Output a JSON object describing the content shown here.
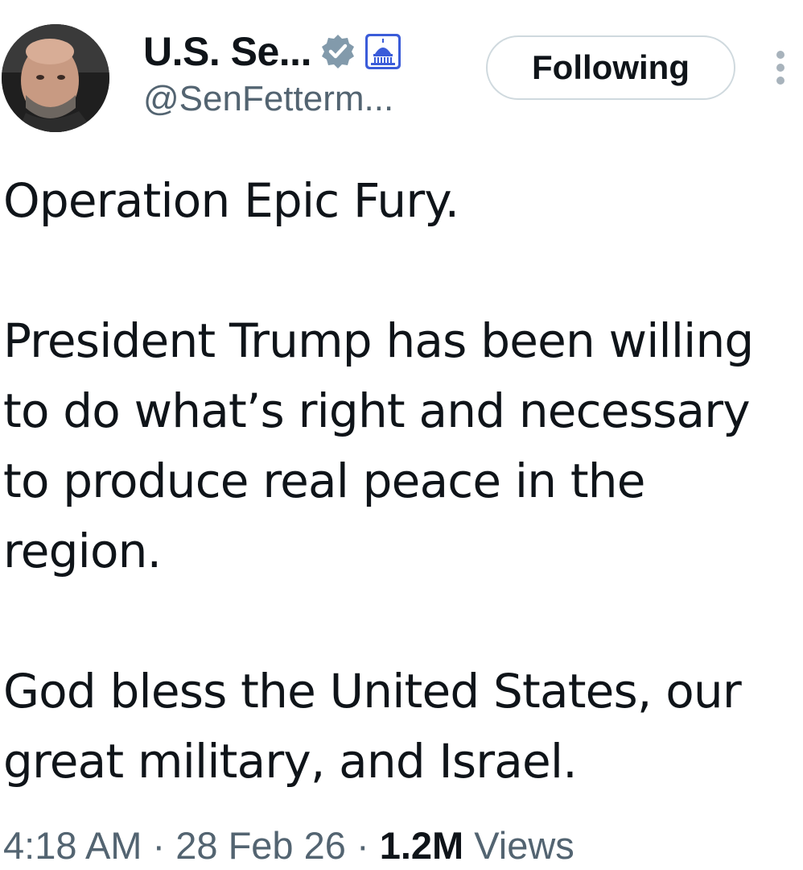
{
  "tweet": {
    "author": {
      "display_name": "U.S. Se...",
      "handle": "@SenFetterm...",
      "verified_badge_icon": "verified-badge-icon",
      "affiliation_icon": "capitol-dome-icon",
      "avatar": "profile-photo"
    },
    "follow_button_label": "Following",
    "more_icon": "more-vertical-icon",
    "paragraphs": [
      "Operation Epic Fury.",
      "President Trump has been willing to do what’s right and necessary to produce real peace in the region.",
      "God bless the United States, our great military, and Israel."
    ],
    "meta": {
      "time": "4:18 AM",
      "separator": " · ",
      "date": "28 Feb 26",
      "views_count": "1.2M",
      "views_label": "Views"
    }
  },
  "colors": {
    "text_primary": "#0f1419",
    "text_secondary": "#536471",
    "button_border": "#cfd9de",
    "badge": "#829aab",
    "affiliation_blue": "#3b5cd9"
  }
}
